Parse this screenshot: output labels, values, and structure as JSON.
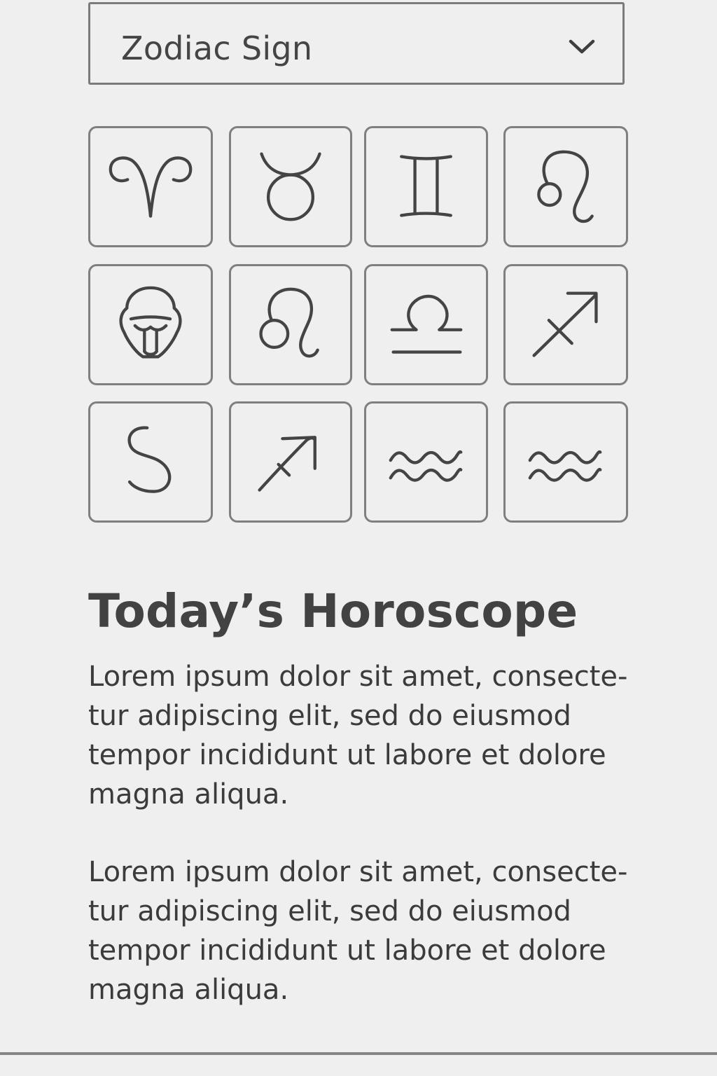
{
  "select": {
    "label": "Zodiac Sign",
    "icon": "chevron-down-icon"
  },
  "zodiac_grid": {
    "icons": [
      "aries-icon",
      "taurus-icon",
      "gemini-icon",
      "leo-glyph-icon",
      "lion-face-icon",
      "leo-icon",
      "libra-icon",
      "sagittarius-icon",
      "swirl-icon",
      "arrow-icon",
      "aquarius-icon",
      "aquarius-alt-icon"
    ]
  },
  "horoscope": {
    "title": "Today’s Horoscope",
    "paragraphs": [
      {
        "lines": [
          "Lorem ipsum dolor sit amet, consecte-",
          "tur adipiscing elit, sed do eiusmod",
          "tempor incididunt ut labore et dolore",
          "magna aliqua."
        ]
      },
      {
        "lines": [
          "Lorem ipsum dolor sit amet, consecte-",
          "tur adipiscing elit, sed do eiusmod",
          "tempor incididunt ut labore et dolore",
          "magna aliqua."
        ]
      }
    ]
  },
  "colors": {
    "background": "#efefef",
    "border": "#7b7b7b",
    "text": "#3e3e3e"
  }
}
